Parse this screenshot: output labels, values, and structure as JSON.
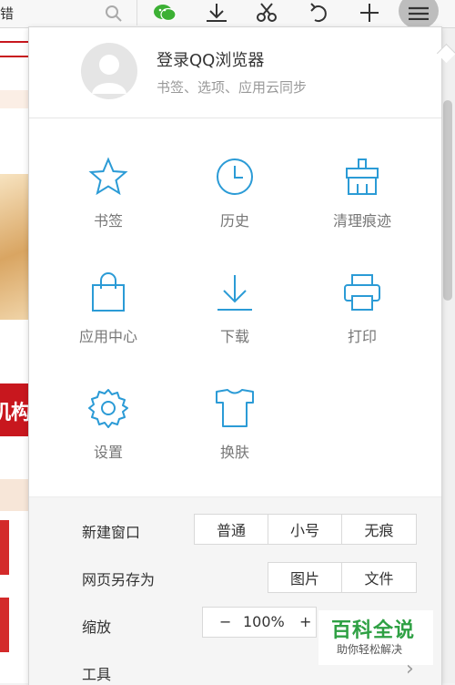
{
  "toolbar": {
    "search_text": "错",
    "icons": [
      "search-icon",
      "wechat-icon",
      "download-icon",
      "scissors-icon",
      "undo-icon",
      "plus-icon",
      "menu-icon"
    ]
  },
  "panel": {
    "login": {
      "title": "登录QQ浏览器",
      "subtitle": "书签、选项、应用云同步"
    },
    "grid": [
      {
        "label": "书签",
        "icon": "star-icon"
      },
      {
        "label": "历史",
        "icon": "clock-icon"
      },
      {
        "label": "清理痕迹",
        "icon": "broom-icon"
      },
      {
        "label": "应用中心",
        "icon": "bag-icon"
      },
      {
        "label": "下载",
        "icon": "download-icon"
      },
      {
        "label": "打印",
        "icon": "printer-icon"
      },
      {
        "label": "设置",
        "icon": "gear-icon"
      },
      {
        "label": "换肤",
        "icon": "tshirt-icon"
      }
    ],
    "settings": {
      "new_window": {
        "label": "新建窗口",
        "options": [
          "普通",
          "小号",
          "无痕"
        ]
      },
      "save_page": {
        "label": "网页另存为",
        "options": [
          "图片",
          "文件"
        ]
      },
      "zoom": {
        "label": "缩放",
        "minus": "−",
        "value": "100%",
        "plus": "+"
      },
      "tools": {
        "label": "工具",
        "chevron": "›"
      }
    }
  },
  "background_page": {
    "text": "机构"
  },
  "watermark": {
    "title": "百科全说",
    "subtitle": "助你轻松解决"
  },
  "colors": {
    "accent": "#2b9bd6",
    "label_gray": "#777777",
    "red": "#c8171e"
  }
}
